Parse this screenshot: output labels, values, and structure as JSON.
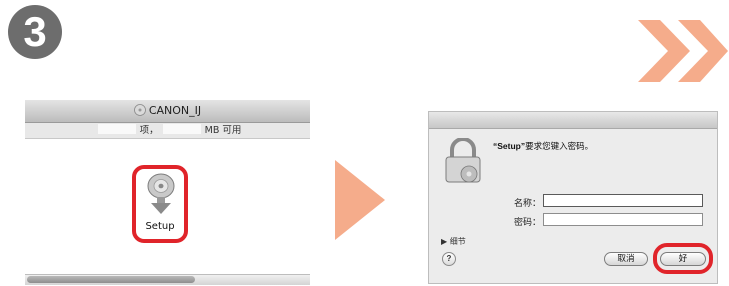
{
  "step": {
    "number": "3"
  },
  "colors": {
    "highlight": "#e0242a",
    "arrow": "#f5ac8b",
    "badge": "#6d6d6d"
  },
  "finder_window": {
    "title": "CANON_IJ",
    "title_icon": "disk-icon",
    "status_items_suffix": "项，",
    "status_space_suffix": "MB 可用",
    "setup_item": {
      "label": "Setup",
      "icon": "installer-disc-icon"
    }
  },
  "auth_dialog": {
    "message_app": "“Setup”",
    "message_text": "要求您键入密码。",
    "lock_icon": "lock-icon",
    "name_label": "名称：",
    "password_label": "密码：",
    "name_value": "",
    "password_value": "",
    "details_label": "▶ 细节",
    "help_label": "?",
    "cancel_label": "取消",
    "ok_label": "好"
  }
}
